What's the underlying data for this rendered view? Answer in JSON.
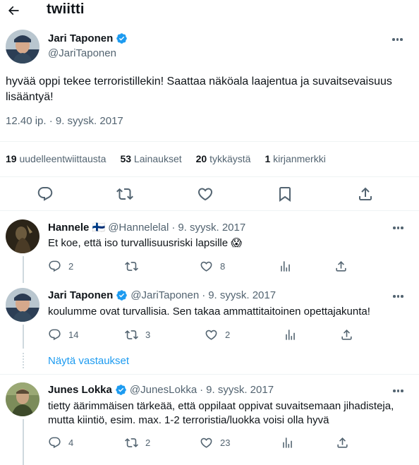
{
  "header": {
    "title": "twiitti",
    "back_icon": "arrow-left-icon"
  },
  "main_tweet": {
    "author_name": "Jari Taponen",
    "author_handle": "@JariTaponen",
    "verified": true,
    "text": "hyvää oppi tekee terroristillekin! Saattaa näköala laajentua ja suvaitsevaisuus lisääntyä!",
    "time": "12.40 ip. · 9. syysk. 2017",
    "stats": {
      "retweets_count": "19",
      "retweets_label": "uudelleentwiittausta",
      "quotes_count": "53",
      "quotes_label": "Lainaukset",
      "likes_count": "20",
      "likes_label": "tykkäystä",
      "bookmarks_count": "1",
      "bookmarks_label": "kirjanmerkki"
    },
    "actions": [
      "reply-icon",
      "retweet-icon",
      "like-icon",
      "bookmark-icon",
      "share-icon"
    ]
  },
  "replies": [
    {
      "name": "Hannele 🇫🇮",
      "handle": "@Hannelelal",
      "date": "9. syysk. 2017",
      "verified": false,
      "text": "Et koe, että iso turvallisuusriski lapsille 😱",
      "reply_count": "2",
      "retweet_count": "",
      "like_count": "8"
    },
    {
      "name": "Jari Taponen",
      "handle": "@JariTaponen",
      "date": "9. syysk. 2017",
      "verified": true,
      "text": "koulumme ovat turvallisia. Sen takaa ammattitaitoinen opettajakunta!",
      "reply_count": "14",
      "retweet_count": "3",
      "like_count": "2"
    },
    {
      "name": "Junes Lokka",
      "handle": "@JunesLokka",
      "date": "9. syysk. 2017",
      "verified": true,
      "text": "tietty äärimmäisen tärkeää, että oppilaat oppivat suvaitsemaan jihadisteja, mutta kiintiö, esim. max. 1-2 terroristia/luokka voisi olla hyvä",
      "reply_count": "4",
      "retweet_count": "2",
      "like_count": "23"
    }
  ],
  "show_replies_label": "Näytä vastaukset",
  "colors": {
    "accent": "#1d9bf0",
    "text_primary": "#0f1419",
    "text_secondary": "#536471",
    "divider": "#eff3f4"
  }
}
